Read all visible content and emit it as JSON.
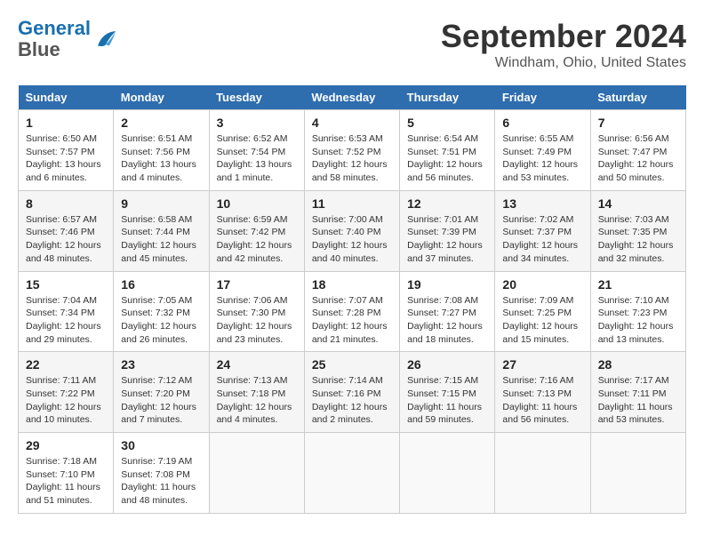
{
  "logo": {
    "line1": "General",
    "line2": "Blue"
  },
  "title": "September 2024",
  "location": "Windham, Ohio, United States",
  "days_of_week": [
    "Sunday",
    "Monday",
    "Tuesday",
    "Wednesday",
    "Thursday",
    "Friday",
    "Saturday"
  ],
  "weeks": [
    [
      {
        "num": "1",
        "info": "Sunrise: 6:50 AM\nSunset: 7:57 PM\nDaylight: 13 hours\nand 6 minutes."
      },
      {
        "num": "2",
        "info": "Sunrise: 6:51 AM\nSunset: 7:56 PM\nDaylight: 13 hours\nand 4 minutes."
      },
      {
        "num": "3",
        "info": "Sunrise: 6:52 AM\nSunset: 7:54 PM\nDaylight: 13 hours\nand 1 minute."
      },
      {
        "num": "4",
        "info": "Sunrise: 6:53 AM\nSunset: 7:52 PM\nDaylight: 12 hours\nand 58 minutes."
      },
      {
        "num": "5",
        "info": "Sunrise: 6:54 AM\nSunset: 7:51 PM\nDaylight: 12 hours\nand 56 minutes."
      },
      {
        "num": "6",
        "info": "Sunrise: 6:55 AM\nSunset: 7:49 PM\nDaylight: 12 hours\nand 53 minutes."
      },
      {
        "num": "7",
        "info": "Sunrise: 6:56 AM\nSunset: 7:47 PM\nDaylight: 12 hours\nand 50 minutes."
      }
    ],
    [
      {
        "num": "8",
        "info": "Sunrise: 6:57 AM\nSunset: 7:46 PM\nDaylight: 12 hours\nand 48 minutes."
      },
      {
        "num": "9",
        "info": "Sunrise: 6:58 AM\nSunset: 7:44 PM\nDaylight: 12 hours\nand 45 minutes."
      },
      {
        "num": "10",
        "info": "Sunrise: 6:59 AM\nSunset: 7:42 PM\nDaylight: 12 hours\nand 42 minutes."
      },
      {
        "num": "11",
        "info": "Sunrise: 7:00 AM\nSunset: 7:40 PM\nDaylight: 12 hours\nand 40 minutes."
      },
      {
        "num": "12",
        "info": "Sunrise: 7:01 AM\nSunset: 7:39 PM\nDaylight: 12 hours\nand 37 minutes."
      },
      {
        "num": "13",
        "info": "Sunrise: 7:02 AM\nSunset: 7:37 PM\nDaylight: 12 hours\nand 34 minutes."
      },
      {
        "num": "14",
        "info": "Sunrise: 7:03 AM\nSunset: 7:35 PM\nDaylight: 12 hours\nand 32 minutes."
      }
    ],
    [
      {
        "num": "15",
        "info": "Sunrise: 7:04 AM\nSunset: 7:34 PM\nDaylight: 12 hours\nand 29 minutes."
      },
      {
        "num": "16",
        "info": "Sunrise: 7:05 AM\nSunset: 7:32 PM\nDaylight: 12 hours\nand 26 minutes."
      },
      {
        "num": "17",
        "info": "Sunrise: 7:06 AM\nSunset: 7:30 PM\nDaylight: 12 hours\nand 23 minutes."
      },
      {
        "num": "18",
        "info": "Sunrise: 7:07 AM\nSunset: 7:28 PM\nDaylight: 12 hours\nand 21 minutes."
      },
      {
        "num": "19",
        "info": "Sunrise: 7:08 AM\nSunset: 7:27 PM\nDaylight: 12 hours\nand 18 minutes."
      },
      {
        "num": "20",
        "info": "Sunrise: 7:09 AM\nSunset: 7:25 PM\nDaylight: 12 hours\nand 15 minutes."
      },
      {
        "num": "21",
        "info": "Sunrise: 7:10 AM\nSunset: 7:23 PM\nDaylight: 12 hours\nand 13 minutes."
      }
    ],
    [
      {
        "num": "22",
        "info": "Sunrise: 7:11 AM\nSunset: 7:22 PM\nDaylight: 12 hours\nand 10 minutes."
      },
      {
        "num": "23",
        "info": "Sunrise: 7:12 AM\nSunset: 7:20 PM\nDaylight: 12 hours\nand 7 minutes."
      },
      {
        "num": "24",
        "info": "Sunrise: 7:13 AM\nSunset: 7:18 PM\nDaylight: 12 hours\nand 4 minutes."
      },
      {
        "num": "25",
        "info": "Sunrise: 7:14 AM\nSunset: 7:16 PM\nDaylight: 12 hours\nand 2 minutes."
      },
      {
        "num": "26",
        "info": "Sunrise: 7:15 AM\nSunset: 7:15 PM\nDaylight: 11 hours\nand 59 minutes."
      },
      {
        "num": "27",
        "info": "Sunrise: 7:16 AM\nSunset: 7:13 PM\nDaylight: 11 hours\nand 56 minutes."
      },
      {
        "num": "28",
        "info": "Sunrise: 7:17 AM\nSunset: 7:11 PM\nDaylight: 11 hours\nand 53 minutes."
      }
    ],
    [
      {
        "num": "29",
        "info": "Sunrise: 7:18 AM\nSunset: 7:10 PM\nDaylight: 11 hours\nand 51 minutes."
      },
      {
        "num": "30",
        "info": "Sunrise: 7:19 AM\nSunset: 7:08 PM\nDaylight: 11 hours\nand 48 minutes."
      },
      {
        "num": "",
        "info": ""
      },
      {
        "num": "",
        "info": ""
      },
      {
        "num": "",
        "info": ""
      },
      {
        "num": "",
        "info": ""
      },
      {
        "num": "",
        "info": ""
      }
    ]
  ]
}
